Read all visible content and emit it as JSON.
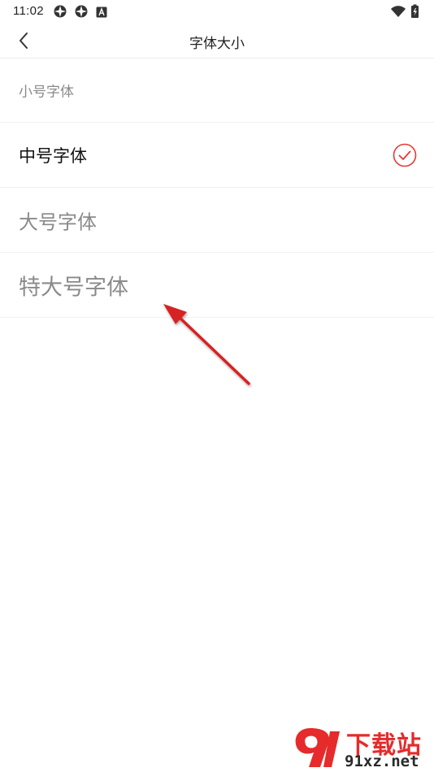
{
  "status_bar": {
    "time": "11:02",
    "left_icons": [
      "app-icon",
      "app-icon",
      "notification-a-icon"
    ],
    "right_icons": [
      "wifi-icon",
      "battery-icon"
    ]
  },
  "header": {
    "title": "字体大小",
    "back_icon": "chevron-left-icon"
  },
  "font_options": [
    {
      "label": "小号字体",
      "selected": false
    },
    {
      "label": "中号字体",
      "selected": true
    },
    {
      "label": "大号字体",
      "selected": false
    },
    {
      "label": "特大号字体",
      "selected": false
    }
  ],
  "colors": {
    "accent": "#e53935",
    "annotation_arrow": "#d62020",
    "selected_text": "#111111",
    "unselected_text": "#8a8a8a"
  },
  "watermark": {
    "title": "下载站",
    "url": "91xz.net"
  }
}
